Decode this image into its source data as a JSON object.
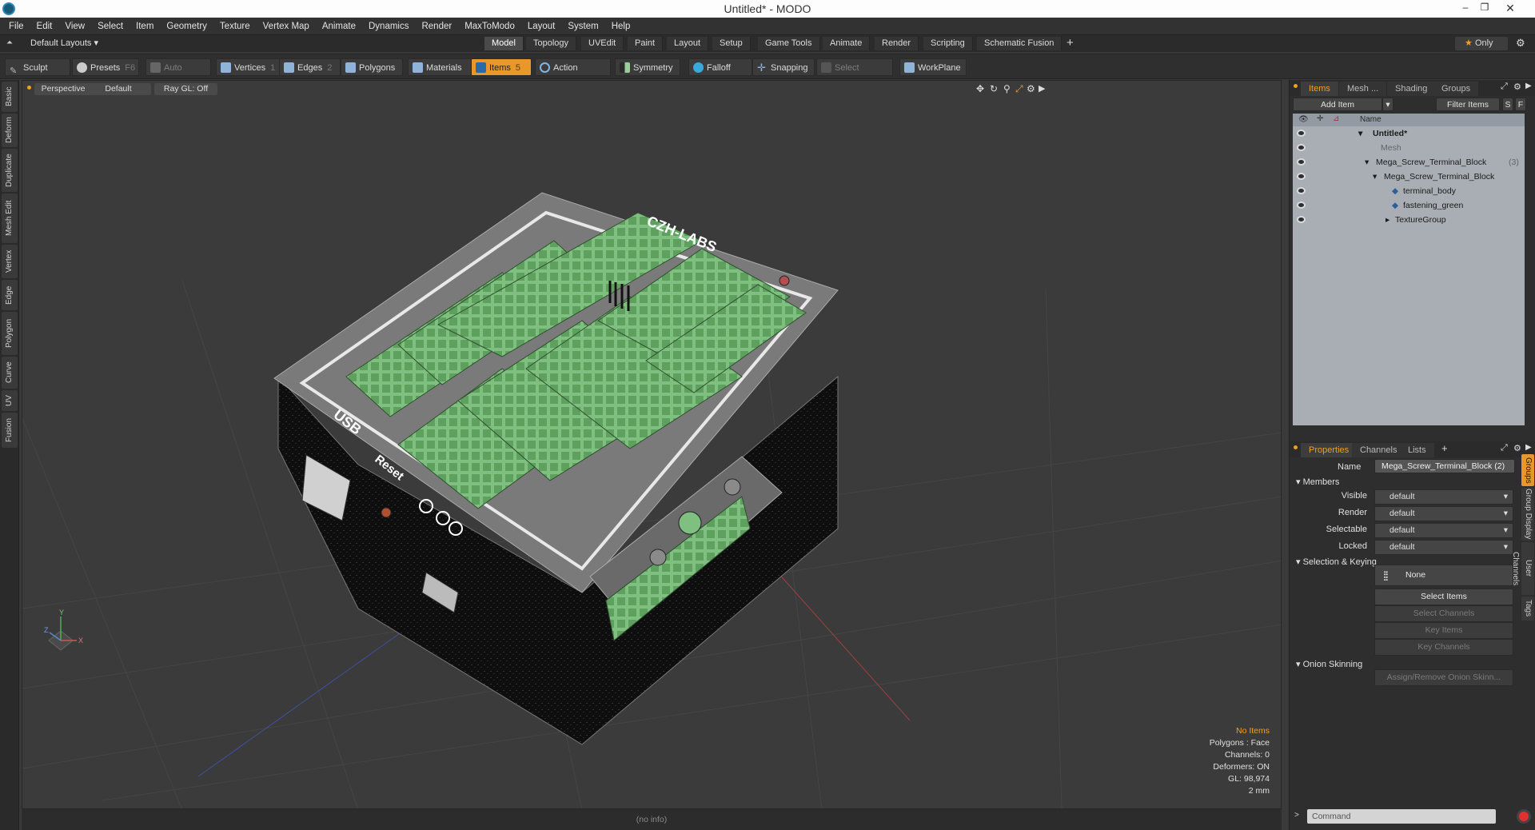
{
  "window": {
    "title": "Untitled* - MODO"
  },
  "menu": [
    "File",
    "Edit",
    "View",
    "Select",
    "Item",
    "Geometry",
    "Texture",
    "Vertex Map",
    "Animate",
    "Dynamics",
    "Render",
    "MaxToModo",
    "Layout",
    "System",
    "Help"
  ],
  "layout_selector": "Default Layouts ▾",
  "layout_tabs": [
    "Model",
    "Topology",
    "UVEdit",
    "Paint",
    "Layout",
    "Setup",
    "Game Tools",
    "Animate",
    "Render",
    "Scripting",
    "Schematic Fusion"
  ],
  "only_label": "Only",
  "toolbar": {
    "sculpt": "Sculpt",
    "presets": "Presets",
    "presets_key": "F6",
    "auto_select": "Auto Select",
    "vertices": "Vertices",
    "vertices_key": "1",
    "edges": "Edges",
    "edges_key": "2",
    "polygons": "Polygons",
    "materials": "Materials",
    "items": "Items",
    "items_key": "5",
    "action_center": "Action Center",
    "symmetry": "Symmetry",
    "falloff": "Falloff",
    "snapping": "Snapping",
    "select_through": "Select Through",
    "workplane": "WorkPlane"
  },
  "left_tabs": [
    "Basic",
    "Deform",
    "Duplicate",
    "Mesh Edit",
    "Vertex",
    "Edge",
    "Polygon",
    "Curve",
    "UV",
    "Fusion"
  ],
  "viewport": {
    "view": "Perspective",
    "style": "Default",
    "raygl": "Ray GL: Off",
    "stats": {
      "items": "No Items",
      "polygons": "Polygons : Face",
      "channels": "Channels: 0",
      "deformers": "Deformers: ON",
      "gl": "GL: 98,974",
      "scale": "2 mm"
    },
    "model_labels": {
      "brand": "CZH-LABS",
      "usb": "USB",
      "reset": "Reset"
    },
    "axis": {
      "x": "X",
      "y": "Y",
      "z": "Z"
    }
  },
  "status_text": "(no info)",
  "items_panel": {
    "tabs": [
      "Items",
      "Mesh ...",
      "Shading",
      "Groups"
    ],
    "add_item": "Add Item",
    "filter_items": "Filter Items",
    "s_btn": "S",
    "f_btn": "F",
    "col_name": "Name",
    "rows": [
      {
        "label": "Untitled*",
        "indent": 0
      },
      {
        "label": "Mesh",
        "indent": 1
      },
      {
        "label": "Mega_Screw_Terminal_Block",
        "count": "(3)",
        "indent": 1
      },
      {
        "label": "Mega_Screw_Terminal_Block",
        "indent": 2
      },
      {
        "label": "terminal_body",
        "indent": 3
      },
      {
        "label": "fastening_green",
        "indent": 3
      },
      {
        "label": "TextureGroup",
        "indent": 2
      }
    ]
  },
  "properties_panel": {
    "tabs": [
      "Properties",
      "Channels",
      "Lists"
    ],
    "name_label": "Name",
    "name_value": "Mega_Screw_Terminal_Block (2)",
    "members_header": "Members",
    "fields": [
      {
        "label": "Visible",
        "value": "default"
      },
      {
        "label": "Render",
        "value": "default"
      },
      {
        "label": "Selectable",
        "value": "default"
      },
      {
        "label": "Locked",
        "value": "default"
      }
    ],
    "selection_header": "Selection & Keying",
    "none_label": "None",
    "select_items": "Select Items",
    "select_channels": "Select Channels",
    "key_items": "Key Items",
    "key_channels": "Key Channels",
    "onion_header": "Onion Skinning",
    "onion_button": "Assign/Remove Onion Skinn...",
    "side_tabs": [
      "Groups",
      "Group Display",
      "User Channels",
      "Tags"
    ]
  },
  "command_placeholder": "Command"
}
